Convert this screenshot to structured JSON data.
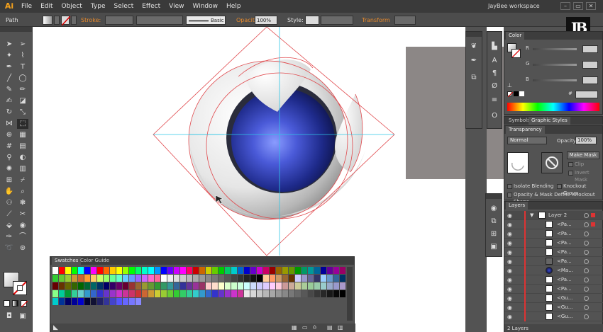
{
  "app": {
    "logo": "Ai",
    "menu": [
      "File",
      "Edit",
      "Object",
      "Type",
      "Select",
      "Effect",
      "View",
      "Window",
      "Help"
    ],
    "workspace": "JayBee workspace",
    "window_buttons": [
      "–",
      "▭",
      "✕"
    ]
  },
  "control_bar": {
    "selection_label": "Path",
    "stroke_label": "Stroke:",
    "brush_label": "Basic",
    "opacity_label": "Opacity:",
    "opacity_value": "100%",
    "style_label": "Style:",
    "transform_label": "Transform"
  },
  "brand_badge": "JB",
  "color_panel": {
    "tab": "Color",
    "channels": [
      "R",
      "G",
      "B"
    ]
  },
  "graphic_styles_panel": {
    "tabs": [
      "Symbols",
      "Graphic Styles"
    ]
  },
  "transparency_panel": {
    "tab": "Transparency",
    "blend_mode": "Normal",
    "opacity_label": "Opacity:",
    "opacity_value": "100%",
    "make_mask": "Make Mask",
    "clip": "Clip",
    "invert_mask": "Invert Mask",
    "isolate_blending": "Isolate Blending",
    "knockout_group": "Knockout Group",
    "opacity_mask_define": "Opacity & Mask Define Knockout Shape"
  },
  "layers_panel": {
    "tab": "Layers",
    "rows": [
      {
        "name": "Layer 2",
        "type": "layer"
      },
      {
        "name": "<Pa...",
        "type": "path"
      },
      {
        "name": "<Pa...",
        "type": "path"
      },
      {
        "name": "<Pa...",
        "type": "path"
      },
      {
        "name": "<Pa...",
        "type": "path"
      },
      {
        "name": "<Pa...",
        "type": "path"
      },
      {
        "name": "<Ma...",
        "type": "mask"
      },
      {
        "name": "<Pa...",
        "type": "path"
      },
      {
        "name": "<Pa...",
        "type": "path"
      },
      {
        "name": "<Gu...",
        "type": "guide"
      },
      {
        "name": "<Gu...",
        "type": "guide"
      },
      {
        "name": "<Gu...",
        "type": "guide"
      }
    ],
    "footer": "2 Layers"
  },
  "swatches_panel": {
    "tabs": [
      "Swatches",
      "Color Guide"
    ]
  },
  "colors": {
    "accent_orange": "#e88a2c",
    "layer_red": "#dd3333",
    "guide_cyan": "#2ec6e6"
  },
  "icons": {
    "selection": "arrow-icon",
    "pen": "pen-icon",
    "type": "type-icon",
    "eye": "eye-icon",
    "mask": "circle-slash-icon"
  }
}
